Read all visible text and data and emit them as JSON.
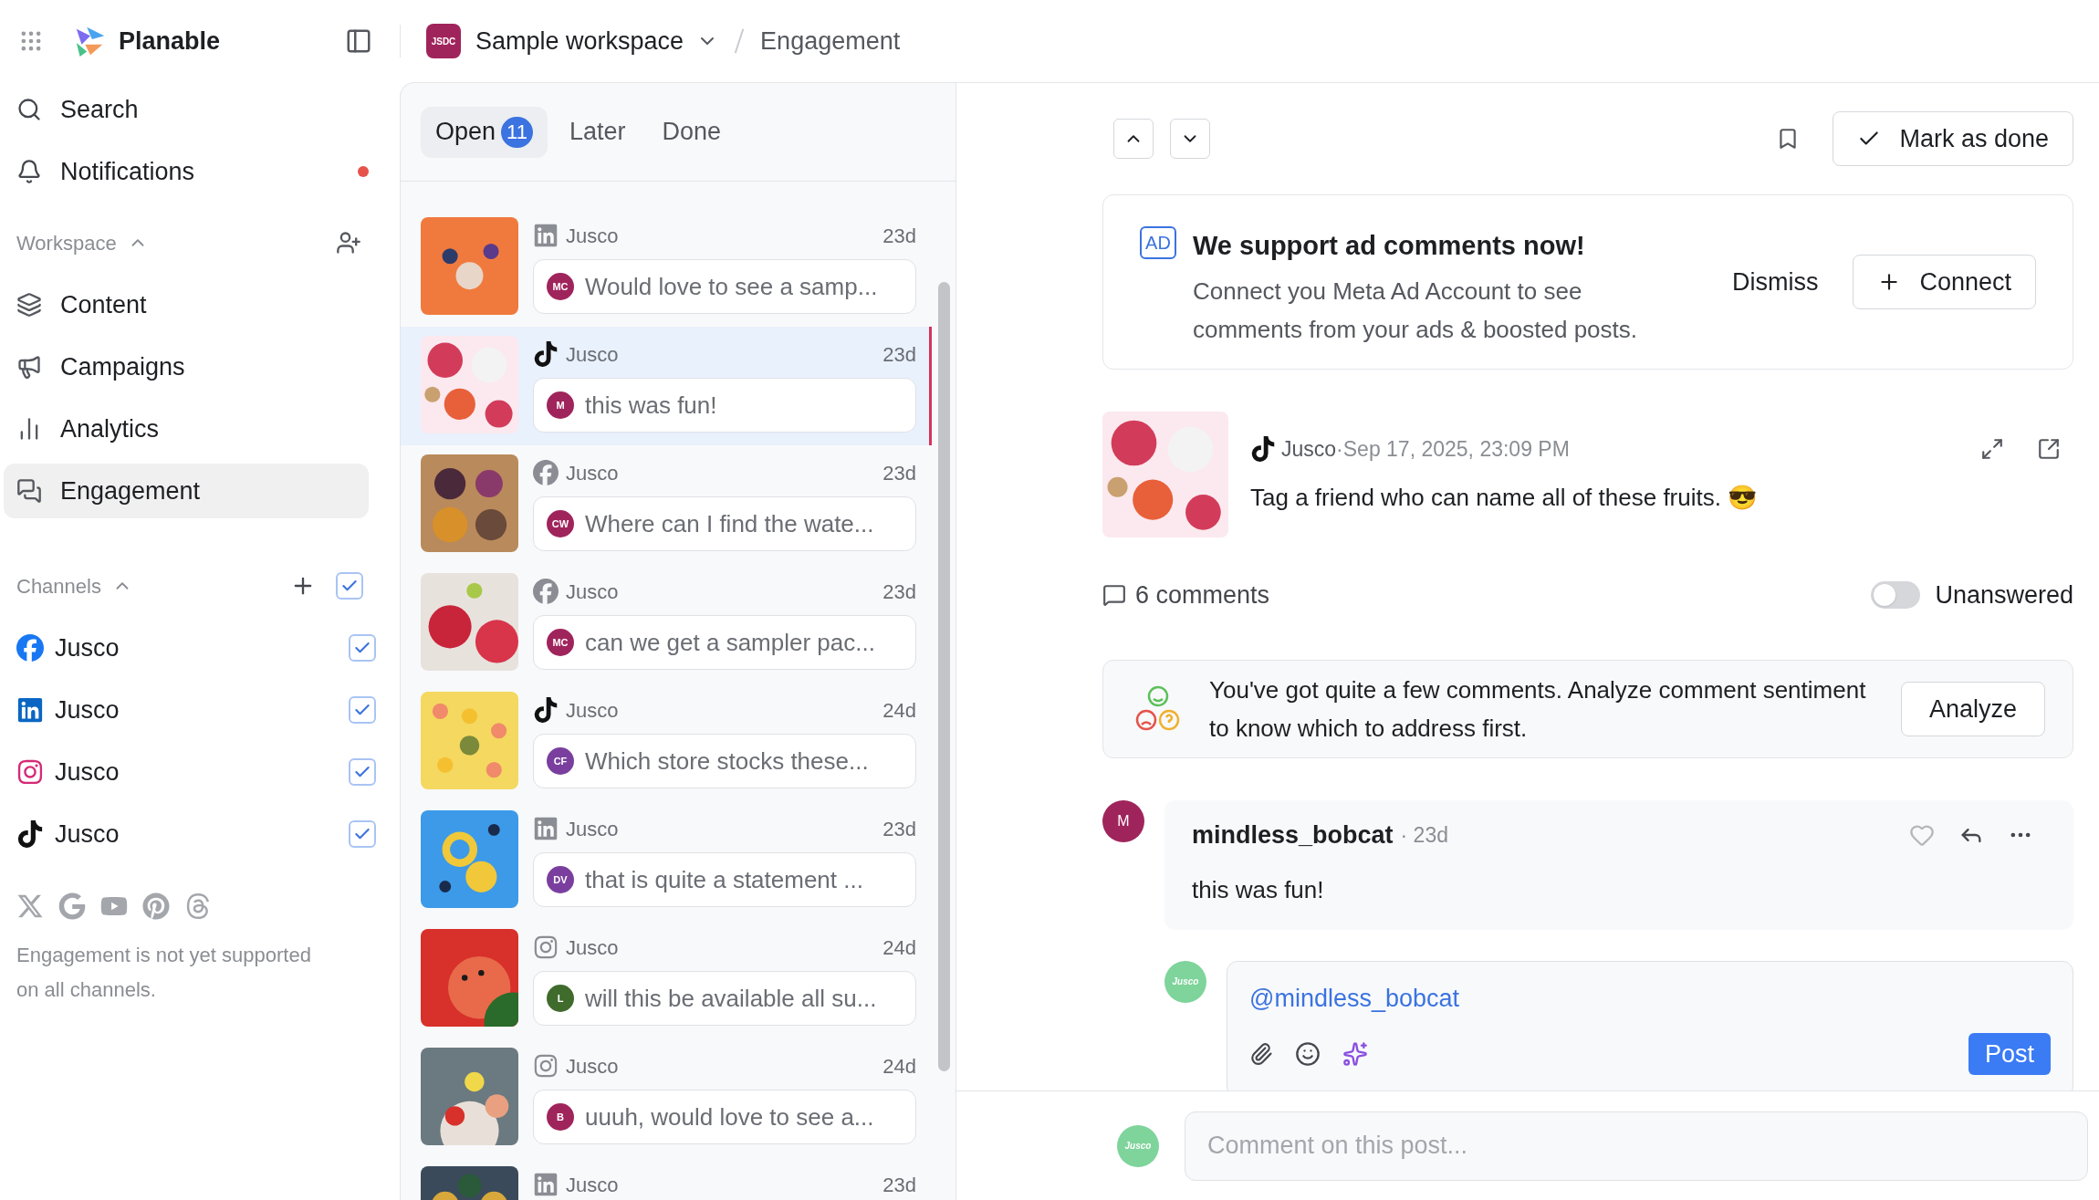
{
  "app": {
    "name": "Planable"
  },
  "breadcrumb": {
    "workspace_badge": "JSDC",
    "workspace": "Sample workspace",
    "page": "Engagement"
  },
  "sidebar": {
    "nav_top": [
      {
        "kind": "search",
        "label": "Search",
        "unread": false
      },
      {
        "kind": "notifications",
        "label": "Notifications",
        "unread": true
      }
    ],
    "workspace_heading": "Workspace",
    "workspace_expanded": true,
    "nav": [
      {
        "kind": "content",
        "label": "Content",
        "selected": false
      },
      {
        "kind": "campaigns",
        "label": "Campaigns",
        "selected": false
      },
      {
        "kind": "analytics",
        "label": "Analytics",
        "selected": false
      },
      {
        "kind": "engagement",
        "label": "Engagement",
        "selected": true
      }
    ],
    "channels_heading": "Channels",
    "channels_expanded": true,
    "channels_all_checked": true,
    "channels": [
      {
        "kind": "facebook",
        "name": "Jusco",
        "checked": true
      },
      {
        "kind": "linkedin",
        "name": "Jusco",
        "checked": true
      },
      {
        "kind": "instagram",
        "name": "Jusco",
        "checked": true
      },
      {
        "kind": "tiktok",
        "name": "Jusco",
        "checked": true
      }
    ],
    "unsupported_networks": [
      {
        "kind": "x"
      },
      {
        "kind": "google"
      },
      {
        "kind": "youtube"
      },
      {
        "kind": "pinterest"
      },
      {
        "kind": "threads"
      }
    ],
    "unsupported_note": "Engagement is not yet supported on all channels."
  },
  "inbox": {
    "tabs": [
      {
        "label": "Open",
        "count": "11",
        "selected": true
      },
      {
        "label": "Later",
        "selected": false
      },
      {
        "label": "Done",
        "selected": false
      }
    ],
    "items": [
      {
        "kind": "linkedin",
        "account": "Jusco",
        "age": "23d",
        "initials": "MC",
        "color": "#a0245c",
        "text": "Would love to see a samp...",
        "selected": false
      },
      {
        "kind": "tiktok",
        "account": "Jusco",
        "age": "23d",
        "initials": "M",
        "color": "#a0245c",
        "text": "this was fun!",
        "selected": true
      },
      {
        "kind": "facebook",
        "account": "Jusco",
        "age": "23d",
        "initials": "CW",
        "color": "#a0245c",
        "text": "Where can I find the wate...",
        "selected": false
      },
      {
        "kind": "facebook",
        "account": "Jusco",
        "age": "23d",
        "initials": "MC",
        "color": "#a0245c",
        "text": "can we get a sampler pac...",
        "selected": false
      },
      {
        "kind": "tiktok",
        "account": "Jusco",
        "age": "24d",
        "initials": "CF",
        "color": "#7a3f9e",
        "text": "Which store stocks these...",
        "selected": false
      },
      {
        "kind": "linkedin",
        "account": "Jusco",
        "age": "23d",
        "initials": "DV",
        "color": "#7a3f9e",
        "text": "that is quite a statement ...",
        "selected": false
      },
      {
        "kind": "instagram",
        "account": "Jusco",
        "age": "24d",
        "initials": "L",
        "color": "#3f6b2c",
        "text": "will this be available all su...",
        "selected": false
      },
      {
        "kind": "instagram",
        "account": "Jusco",
        "age": "24d",
        "initials": "B",
        "color": "#a0245c",
        "text": "uuuh, would love to see a...",
        "selected": false
      },
      {
        "kind": "linkedin",
        "account": "Jusco",
        "age": "23d",
        "selected": false
      }
    ]
  },
  "detail": {
    "mark_done": "Mark as done",
    "banner": {
      "badge": "AD",
      "title": "We support ad comments now!",
      "text": "Connect you Meta Ad Account to see comments from your ads & boosted posts.",
      "dismiss": "Dismiss",
      "connect": "Connect"
    },
    "post": {
      "kind": "tiktok",
      "account": "Jusco",
      "date": "·Sep 17, 2025, 23:09 PM",
      "text": "Tag a friend who can name all of these fruits. 😎"
    },
    "comments_count": "6 comments",
    "filter": {
      "label": "Unanswered",
      "on": false
    },
    "sentiment": {
      "text": "You've got quite a few comments. Analyze comment sentiment to know which to address first.",
      "button": "Analyze"
    },
    "comment": {
      "initials": "M",
      "color": "#a0245c",
      "author": "mindless_bobcat",
      "age": "· 23d",
      "text": "this was fun!",
      "liked": false
    },
    "reply": {
      "avatar": "Jusco",
      "mention": "@mindless_bobcat",
      "post": "Post"
    },
    "composer": {
      "avatar": "Jusco",
      "placeholder": "Comment on this post..."
    }
  }
}
